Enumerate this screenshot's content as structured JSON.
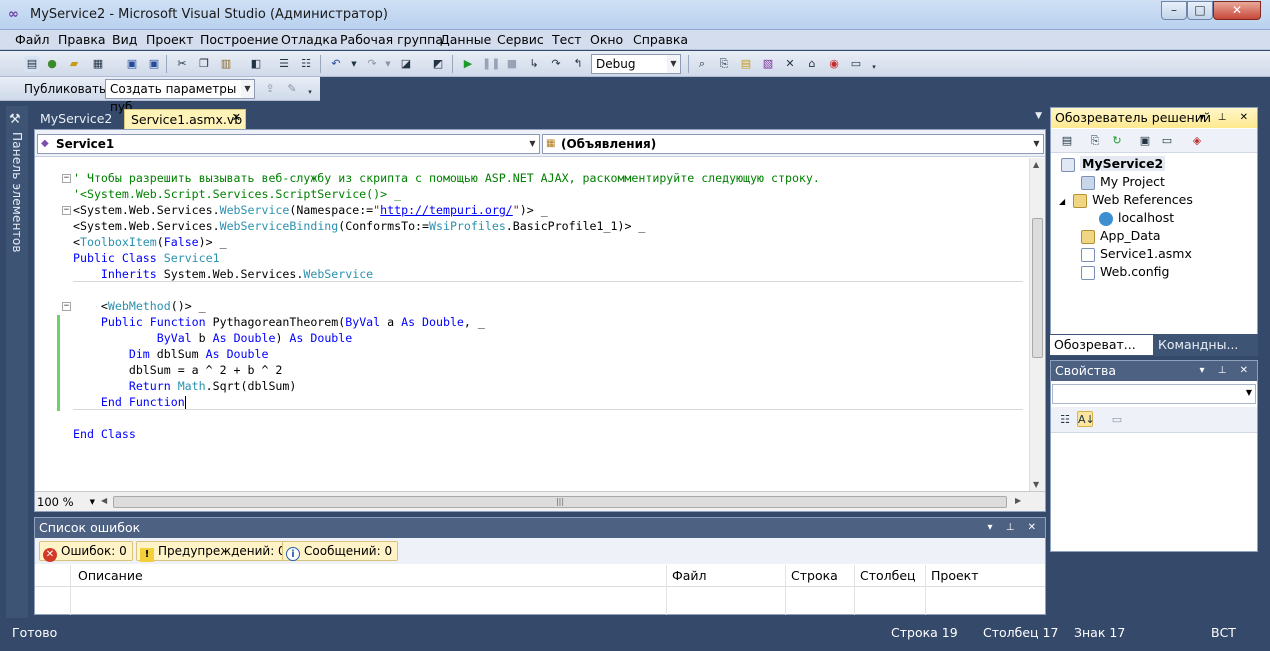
{
  "window": {
    "title": "MyService2 - Microsoft Visual Studio (Администратор)",
    "minimize": "–",
    "maximize": "□",
    "close": "✕"
  },
  "menu": [
    "Файл",
    "Правка",
    "Вид",
    "Проект",
    "Построение",
    "Отладка",
    "Рабочая группа",
    "Данные",
    "Сервис",
    "Тест",
    "Окно",
    "Справка"
  ],
  "toolbar": {
    "config_value": "Debug",
    "publish_label": "Публиковать:",
    "publish_value": "Создать параметры пуб"
  },
  "toolbox": {
    "label": "Панель элементов"
  },
  "tabs": [
    "MyService2",
    "Service1.asmx.vb"
  ],
  "editor": {
    "class_combo": "Service1",
    "member_combo": "(Объявления)",
    "zoom": "100 %",
    "lines": [
      [
        "' Чтобы разрешить вызывать веб-службу из скрипта с помощью ASP.NET AJAX, раскомментируйте следующую строку."
      ],
      [
        "'<System.Web.Script.Services.ScriptService()> _"
      ],
      [
        "<System.Web.Services.",
        "WebService",
        "(Namespace:=",
        "\"",
        "http://tempuri.org/",
        "\"",
        ")> _"
      ],
      [
        "<System.Web.Services.",
        "WebServiceBinding",
        "(ConformsTo:=",
        "WsiProfiles",
        ".BasicProfile1_1)> _"
      ],
      [
        "<",
        "ToolboxItem",
        "(",
        "False",
        ")> _"
      ],
      [
        "Public Class ",
        "Service1"
      ],
      [
        "    Inherits ",
        "System.Web.Services.",
        "WebService"
      ],
      [
        "    <",
        "WebMethod",
        "()> _"
      ],
      [
        "    Public Function ",
        "PythagoreanTheorem(",
        "ByVal",
        " a ",
        "As Double",
        ", _"
      ],
      [
        "            ByVal",
        " b ",
        "As Double",
        ") ",
        "As Double"
      ],
      [
        "        Dim",
        " dblSum ",
        "As Double"
      ],
      [
        "        dblSum = a ^ 2 + b ^ 2"
      ],
      [
        "        Return ",
        "Math",
        ".Sqrt(dblSum)"
      ],
      [
        "    End Function"
      ],
      [
        "End Class"
      ]
    ]
  },
  "solution_explorer": {
    "title": "Обозреватель решений",
    "items": [
      "MyService2",
      "My Project",
      "Web References",
      "localhost",
      "App_Data",
      "Service1.asmx",
      "Web.config"
    ],
    "tabs": [
      "Обозреват...",
      "Командны..."
    ]
  },
  "properties": {
    "title": "Свойства"
  },
  "error_list": {
    "title": "Список ошибок",
    "errors": "Ошибок: 0",
    "warnings": "Предупреждений: 0",
    "messages": "Сообщений: 0",
    "columns": [
      "Описание",
      "Файл",
      "Строка",
      "Столбец",
      "Проект"
    ]
  },
  "status": {
    "ready": "Готово",
    "line": "Строка 19",
    "col": "Столбец 17",
    "char": "Знак 17",
    "mode": "ВСТ"
  },
  "colors": {
    "keyword": "#0000ff",
    "type": "#2b91af",
    "comment": "#008000",
    "chrome": "#35496a",
    "active_tab": "#fff3b8"
  }
}
